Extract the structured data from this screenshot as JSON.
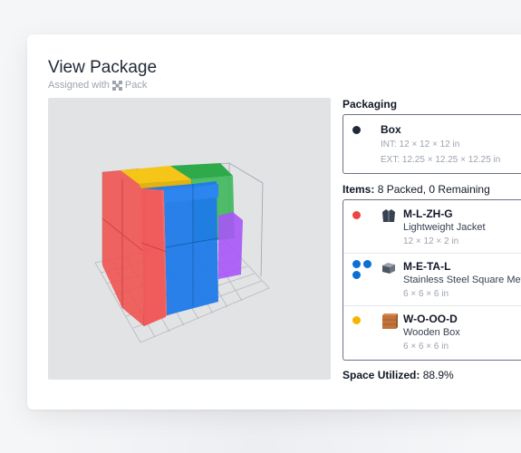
{
  "header": {
    "title": "View Package",
    "subtitle_prefix": "Assigned with",
    "subtitle_brand": "Pack"
  },
  "packaging": {
    "label": "Packaging",
    "box": {
      "name": "Box",
      "int": "INT: 12 × 12 × 12 in",
      "ext": "EXT: 12.25 × 12.25 × 12.25 in",
      "dot_color": "#1f2937"
    }
  },
  "items": {
    "label_prefix": "Items:",
    "label_value": "8 Packed, 0 Remaining",
    "list": [
      {
        "sku": "M-L-ZH-G",
        "name": "Lightweight Jacket",
        "dims": "12 × 12 × 2 in",
        "dot_color": "#ef4444",
        "icon": "jacket-icon"
      },
      {
        "sku": "M-E-TA-L",
        "name": "Stainless Steel Square Metal Box",
        "dims": "6 × 6 × 6 in",
        "dot_color": "#0b6fd6",
        "icon": "metal-box-icon"
      },
      {
        "sku": "W-O-OO-D",
        "name": "Wooden Box",
        "dims": "6 × 6 × 6 in",
        "dot_color": "#f5b400",
        "icon": "wooden-box-icon"
      }
    ]
  },
  "space": {
    "label": "Space Utilized:",
    "value": "88.9%"
  }
}
